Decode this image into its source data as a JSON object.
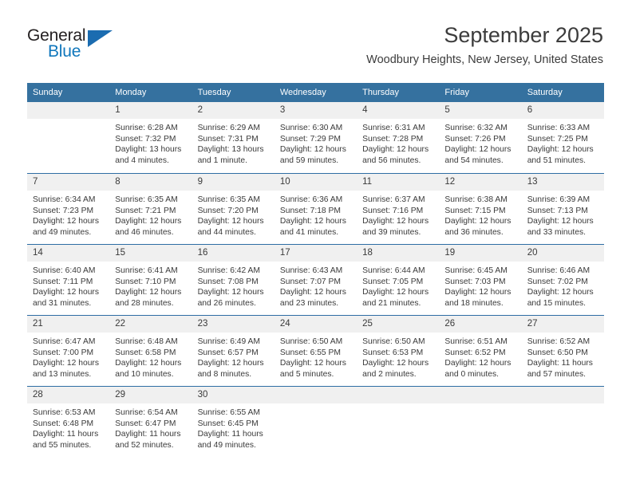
{
  "brand": {
    "name_part1": "General",
    "name_part2": "Blue",
    "accent_color": "#1077bc",
    "triangle_color": "#1b6cb0"
  },
  "header": {
    "title": "September 2025",
    "subtitle": "Woodbury Heights, New Jersey, United States"
  },
  "theme": {
    "header_row_bg": "#35719f",
    "header_row_text": "#ffffff",
    "daynum_bg": "#f0f0f0",
    "row_divider": "#2e6da4"
  },
  "weekdays": [
    "Sunday",
    "Monday",
    "Tuesday",
    "Wednesday",
    "Thursday",
    "Friday",
    "Saturday"
  ],
  "weeks": [
    [
      {
        "day": "",
        "sunrise": "",
        "sunset": "",
        "daylight1": "",
        "daylight2": ""
      },
      {
        "day": "1",
        "sunrise": "Sunrise: 6:28 AM",
        "sunset": "Sunset: 7:32 PM",
        "daylight1": "Daylight: 13 hours",
        "daylight2": "and 4 minutes."
      },
      {
        "day": "2",
        "sunrise": "Sunrise: 6:29 AM",
        "sunset": "Sunset: 7:31 PM",
        "daylight1": "Daylight: 13 hours",
        "daylight2": "and 1 minute."
      },
      {
        "day": "3",
        "sunrise": "Sunrise: 6:30 AM",
        "sunset": "Sunset: 7:29 PM",
        "daylight1": "Daylight: 12 hours",
        "daylight2": "and 59 minutes."
      },
      {
        "day": "4",
        "sunrise": "Sunrise: 6:31 AM",
        "sunset": "Sunset: 7:28 PM",
        "daylight1": "Daylight: 12 hours",
        "daylight2": "and 56 minutes."
      },
      {
        "day": "5",
        "sunrise": "Sunrise: 6:32 AM",
        "sunset": "Sunset: 7:26 PM",
        "daylight1": "Daylight: 12 hours",
        "daylight2": "and 54 minutes."
      },
      {
        "day": "6",
        "sunrise": "Sunrise: 6:33 AM",
        "sunset": "Sunset: 7:25 PM",
        "daylight1": "Daylight: 12 hours",
        "daylight2": "and 51 minutes."
      }
    ],
    [
      {
        "day": "7",
        "sunrise": "Sunrise: 6:34 AM",
        "sunset": "Sunset: 7:23 PM",
        "daylight1": "Daylight: 12 hours",
        "daylight2": "and 49 minutes."
      },
      {
        "day": "8",
        "sunrise": "Sunrise: 6:35 AM",
        "sunset": "Sunset: 7:21 PM",
        "daylight1": "Daylight: 12 hours",
        "daylight2": "and 46 minutes."
      },
      {
        "day": "9",
        "sunrise": "Sunrise: 6:35 AM",
        "sunset": "Sunset: 7:20 PM",
        "daylight1": "Daylight: 12 hours",
        "daylight2": "and 44 minutes."
      },
      {
        "day": "10",
        "sunrise": "Sunrise: 6:36 AM",
        "sunset": "Sunset: 7:18 PM",
        "daylight1": "Daylight: 12 hours",
        "daylight2": "and 41 minutes."
      },
      {
        "day": "11",
        "sunrise": "Sunrise: 6:37 AM",
        "sunset": "Sunset: 7:16 PM",
        "daylight1": "Daylight: 12 hours",
        "daylight2": "and 39 minutes."
      },
      {
        "day": "12",
        "sunrise": "Sunrise: 6:38 AM",
        "sunset": "Sunset: 7:15 PM",
        "daylight1": "Daylight: 12 hours",
        "daylight2": "and 36 minutes."
      },
      {
        "day": "13",
        "sunrise": "Sunrise: 6:39 AM",
        "sunset": "Sunset: 7:13 PM",
        "daylight1": "Daylight: 12 hours",
        "daylight2": "and 33 minutes."
      }
    ],
    [
      {
        "day": "14",
        "sunrise": "Sunrise: 6:40 AM",
        "sunset": "Sunset: 7:11 PM",
        "daylight1": "Daylight: 12 hours",
        "daylight2": "and 31 minutes."
      },
      {
        "day": "15",
        "sunrise": "Sunrise: 6:41 AM",
        "sunset": "Sunset: 7:10 PM",
        "daylight1": "Daylight: 12 hours",
        "daylight2": "and 28 minutes."
      },
      {
        "day": "16",
        "sunrise": "Sunrise: 6:42 AM",
        "sunset": "Sunset: 7:08 PM",
        "daylight1": "Daylight: 12 hours",
        "daylight2": "and 26 minutes."
      },
      {
        "day": "17",
        "sunrise": "Sunrise: 6:43 AM",
        "sunset": "Sunset: 7:07 PM",
        "daylight1": "Daylight: 12 hours",
        "daylight2": "and 23 minutes."
      },
      {
        "day": "18",
        "sunrise": "Sunrise: 6:44 AM",
        "sunset": "Sunset: 7:05 PM",
        "daylight1": "Daylight: 12 hours",
        "daylight2": "and 21 minutes."
      },
      {
        "day": "19",
        "sunrise": "Sunrise: 6:45 AM",
        "sunset": "Sunset: 7:03 PM",
        "daylight1": "Daylight: 12 hours",
        "daylight2": "and 18 minutes."
      },
      {
        "day": "20",
        "sunrise": "Sunrise: 6:46 AM",
        "sunset": "Sunset: 7:02 PM",
        "daylight1": "Daylight: 12 hours",
        "daylight2": "and 15 minutes."
      }
    ],
    [
      {
        "day": "21",
        "sunrise": "Sunrise: 6:47 AM",
        "sunset": "Sunset: 7:00 PM",
        "daylight1": "Daylight: 12 hours",
        "daylight2": "and 13 minutes."
      },
      {
        "day": "22",
        "sunrise": "Sunrise: 6:48 AM",
        "sunset": "Sunset: 6:58 PM",
        "daylight1": "Daylight: 12 hours",
        "daylight2": "and 10 minutes."
      },
      {
        "day": "23",
        "sunrise": "Sunrise: 6:49 AM",
        "sunset": "Sunset: 6:57 PM",
        "daylight1": "Daylight: 12 hours",
        "daylight2": "and 8 minutes."
      },
      {
        "day": "24",
        "sunrise": "Sunrise: 6:50 AM",
        "sunset": "Sunset: 6:55 PM",
        "daylight1": "Daylight: 12 hours",
        "daylight2": "and 5 minutes."
      },
      {
        "day": "25",
        "sunrise": "Sunrise: 6:50 AM",
        "sunset": "Sunset: 6:53 PM",
        "daylight1": "Daylight: 12 hours",
        "daylight2": "and 2 minutes."
      },
      {
        "day": "26",
        "sunrise": "Sunrise: 6:51 AM",
        "sunset": "Sunset: 6:52 PM",
        "daylight1": "Daylight: 12 hours",
        "daylight2": "and 0 minutes."
      },
      {
        "day": "27",
        "sunrise": "Sunrise: 6:52 AM",
        "sunset": "Sunset: 6:50 PM",
        "daylight1": "Daylight: 11 hours",
        "daylight2": "and 57 minutes."
      }
    ],
    [
      {
        "day": "28",
        "sunrise": "Sunrise: 6:53 AM",
        "sunset": "Sunset: 6:48 PM",
        "daylight1": "Daylight: 11 hours",
        "daylight2": "and 55 minutes."
      },
      {
        "day": "29",
        "sunrise": "Sunrise: 6:54 AM",
        "sunset": "Sunset: 6:47 PM",
        "daylight1": "Daylight: 11 hours",
        "daylight2": "and 52 minutes."
      },
      {
        "day": "30",
        "sunrise": "Sunrise: 6:55 AM",
        "sunset": "Sunset: 6:45 PM",
        "daylight1": "Daylight: 11 hours",
        "daylight2": "and 49 minutes."
      },
      {
        "day": "",
        "sunrise": "",
        "sunset": "",
        "daylight1": "",
        "daylight2": ""
      },
      {
        "day": "",
        "sunrise": "",
        "sunset": "",
        "daylight1": "",
        "daylight2": ""
      },
      {
        "day": "",
        "sunrise": "",
        "sunset": "",
        "daylight1": "",
        "daylight2": ""
      },
      {
        "day": "",
        "sunrise": "",
        "sunset": "",
        "daylight1": "",
        "daylight2": ""
      }
    ]
  ]
}
